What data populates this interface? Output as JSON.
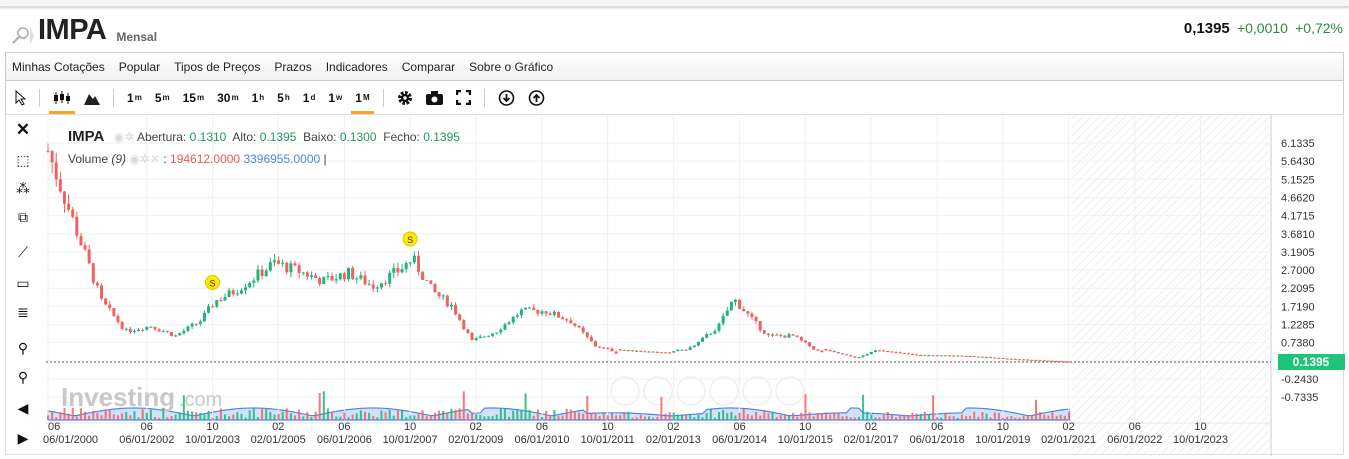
{
  "header": {
    "symbol": "IMPA",
    "period": "Mensal",
    "last": "0,1395",
    "change": "+0,0010",
    "change_pct": "+0,72%"
  },
  "menu": [
    "Minhas Cotações",
    "Popular",
    "Tipos de Preços",
    "Prazos",
    "Indicadores",
    "Comparar",
    "Sobre o Gráfico"
  ],
  "toolbar": {
    "intervals": [
      "1|m",
      "5|m",
      "15|m",
      "30|m",
      "1|h",
      "5|h",
      "1|d",
      "1|w",
      "1|M"
    ],
    "active_interval": "1M",
    "chart_type_active": "candles"
  },
  "legend": {
    "symbol": "IMPA",
    "open_label": "Abertura:",
    "open": "0.1310",
    "high_label": "Alto:",
    "high": "0.1395",
    "low_label": "Baixo:",
    "low": "0.1300",
    "close_label": "Fecho:",
    "close": "0.1395",
    "volume_label": "Volume",
    "volume_param": "(9)",
    "volume_value": "194612.0000",
    "volume_ma": "3396955.0000"
  },
  "watermark": "Investing.com",
  "colors": {
    "up": "#1fb57a",
    "down": "#f0625f",
    "accent": "#f5a623",
    "price_tag": "#1fc47a"
  },
  "chart_data": {
    "type": "candlestick",
    "y_ticks": [
      "6.1335",
      "5.6430",
      "5.1525",
      "4.6620",
      "4.1715",
      "3.6810",
      "3.1905",
      "2.7000",
      "2.2095",
      "1.7190",
      "1.2285",
      "0.7380",
      "-0.2430",
      "-0.7335"
    ],
    "ylim": [
      -0.7335,
      6.1335
    ],
    "current_price": "0.1395",
    "x_ticks": [
      [
        "06",
        "06/01/2000"
      ],
      [
        "06",
        "06/01/2002"
      ],
      [
        "10",
        "10/01/2003"
      ],
      [
        "02",
        "02/01/2005"
      ],
      [
        "06",
        "06/01/2006"
      ],
      [
        "10",
        "10/01/2007"
      ],
      [
        "02",
        "02/01/2009"
      ],
      [
        "06",
        "06/01/2010"
      ],
      [
        "10",
        "10/01/2011"
      ],
      [
        "02",
        "02/01/2013"
      ],
      [
        "06",
        "06/01/2014"
      ],
      [
        "10",
        "10/01/2015"
      ],
      [
        "02",
        "02/01/2017"
      ],
      [
        "06",
        "06/01/2018"
      ],
      [
        "10",
        "10/01/2019"
      ],
      [
        "02",
        "02/01/2021"
      ],
      [
        "06",
        "06/01/2022"
      ],
      [
        "10",
        "10/01/2023"
      ]
    ],
    "close_series": [
      [
        2000.42,
        5.92
      ],
      [
        2000.6,
        5.24
      ],
      [
        2001.0,
        3.76
      ],
      [
        2001.5,
        1.86
      ],
      [
        2002.0,
        1.05
      ],
      [
        2002.5,
        1.19
      ],
      [
        2003.0,
        0.92
      ],
      [
        2003.5,
        1.32
      ],
      [
        2003.8,
        1.86
      ],
      [
        2004.2,
        2.13
      ],
      [
        2005.0,
        2.89
      ],
      [
        2005.5,
        2.67
      ],
      [
        2006.0,
        2.4
      ],
      [
        2006.5,
        2.62
      ],
      [
        2007.0,
        2.27
      ],
      [
        2007.5,
        2.67
      ],
      [
        2007.8,
        3.0
      ],
      [
        2008.2,
        2.13
      ],
      [
        2008.6,
        1.73
      ],
      [
        2009.0,
        0.78
      ],
      [
        2009.5,
        1.05
      ],
      [
        2010.0,
        1.59
      ],
      [
        2010.5,
        1.59
      ],
      [
        2011.0,
        1.32
      ],
      [
        2011.5,
        0.65
      ],
      [
        2012.0,
        0.46
      ],
      [
        2013.0,
        0.38
      ],
      [
        2013.5,
        0.65
      ],
      [
        2014.0,
        1.19
      ],
      [
        2014.3,
        1.92
      ],
      [
        2014.7,
        1.32
      ],
      [
        2015.0,
        0.92
      ],
      [
        2015.5,
        0.92
      ],
      [
        2016.0,
        0.51
      ],
      [
        2016.8,
        0.24
      ],
      [
        2017.2,
        0.46
      ],
      [
        2018.0,
        0.32
      ],
      [
        2019.0,
        0.3
      ],
      [
        2020.0,
        0.21
      ],
      [
        2021.1,
        0.14
      ]
    ],
    "markers": [
      {
        "label": "S",
        "date": 2003.75
      },
      {
        "label": "S",
        "date": 2007.75
      }
    ]
  }
}
